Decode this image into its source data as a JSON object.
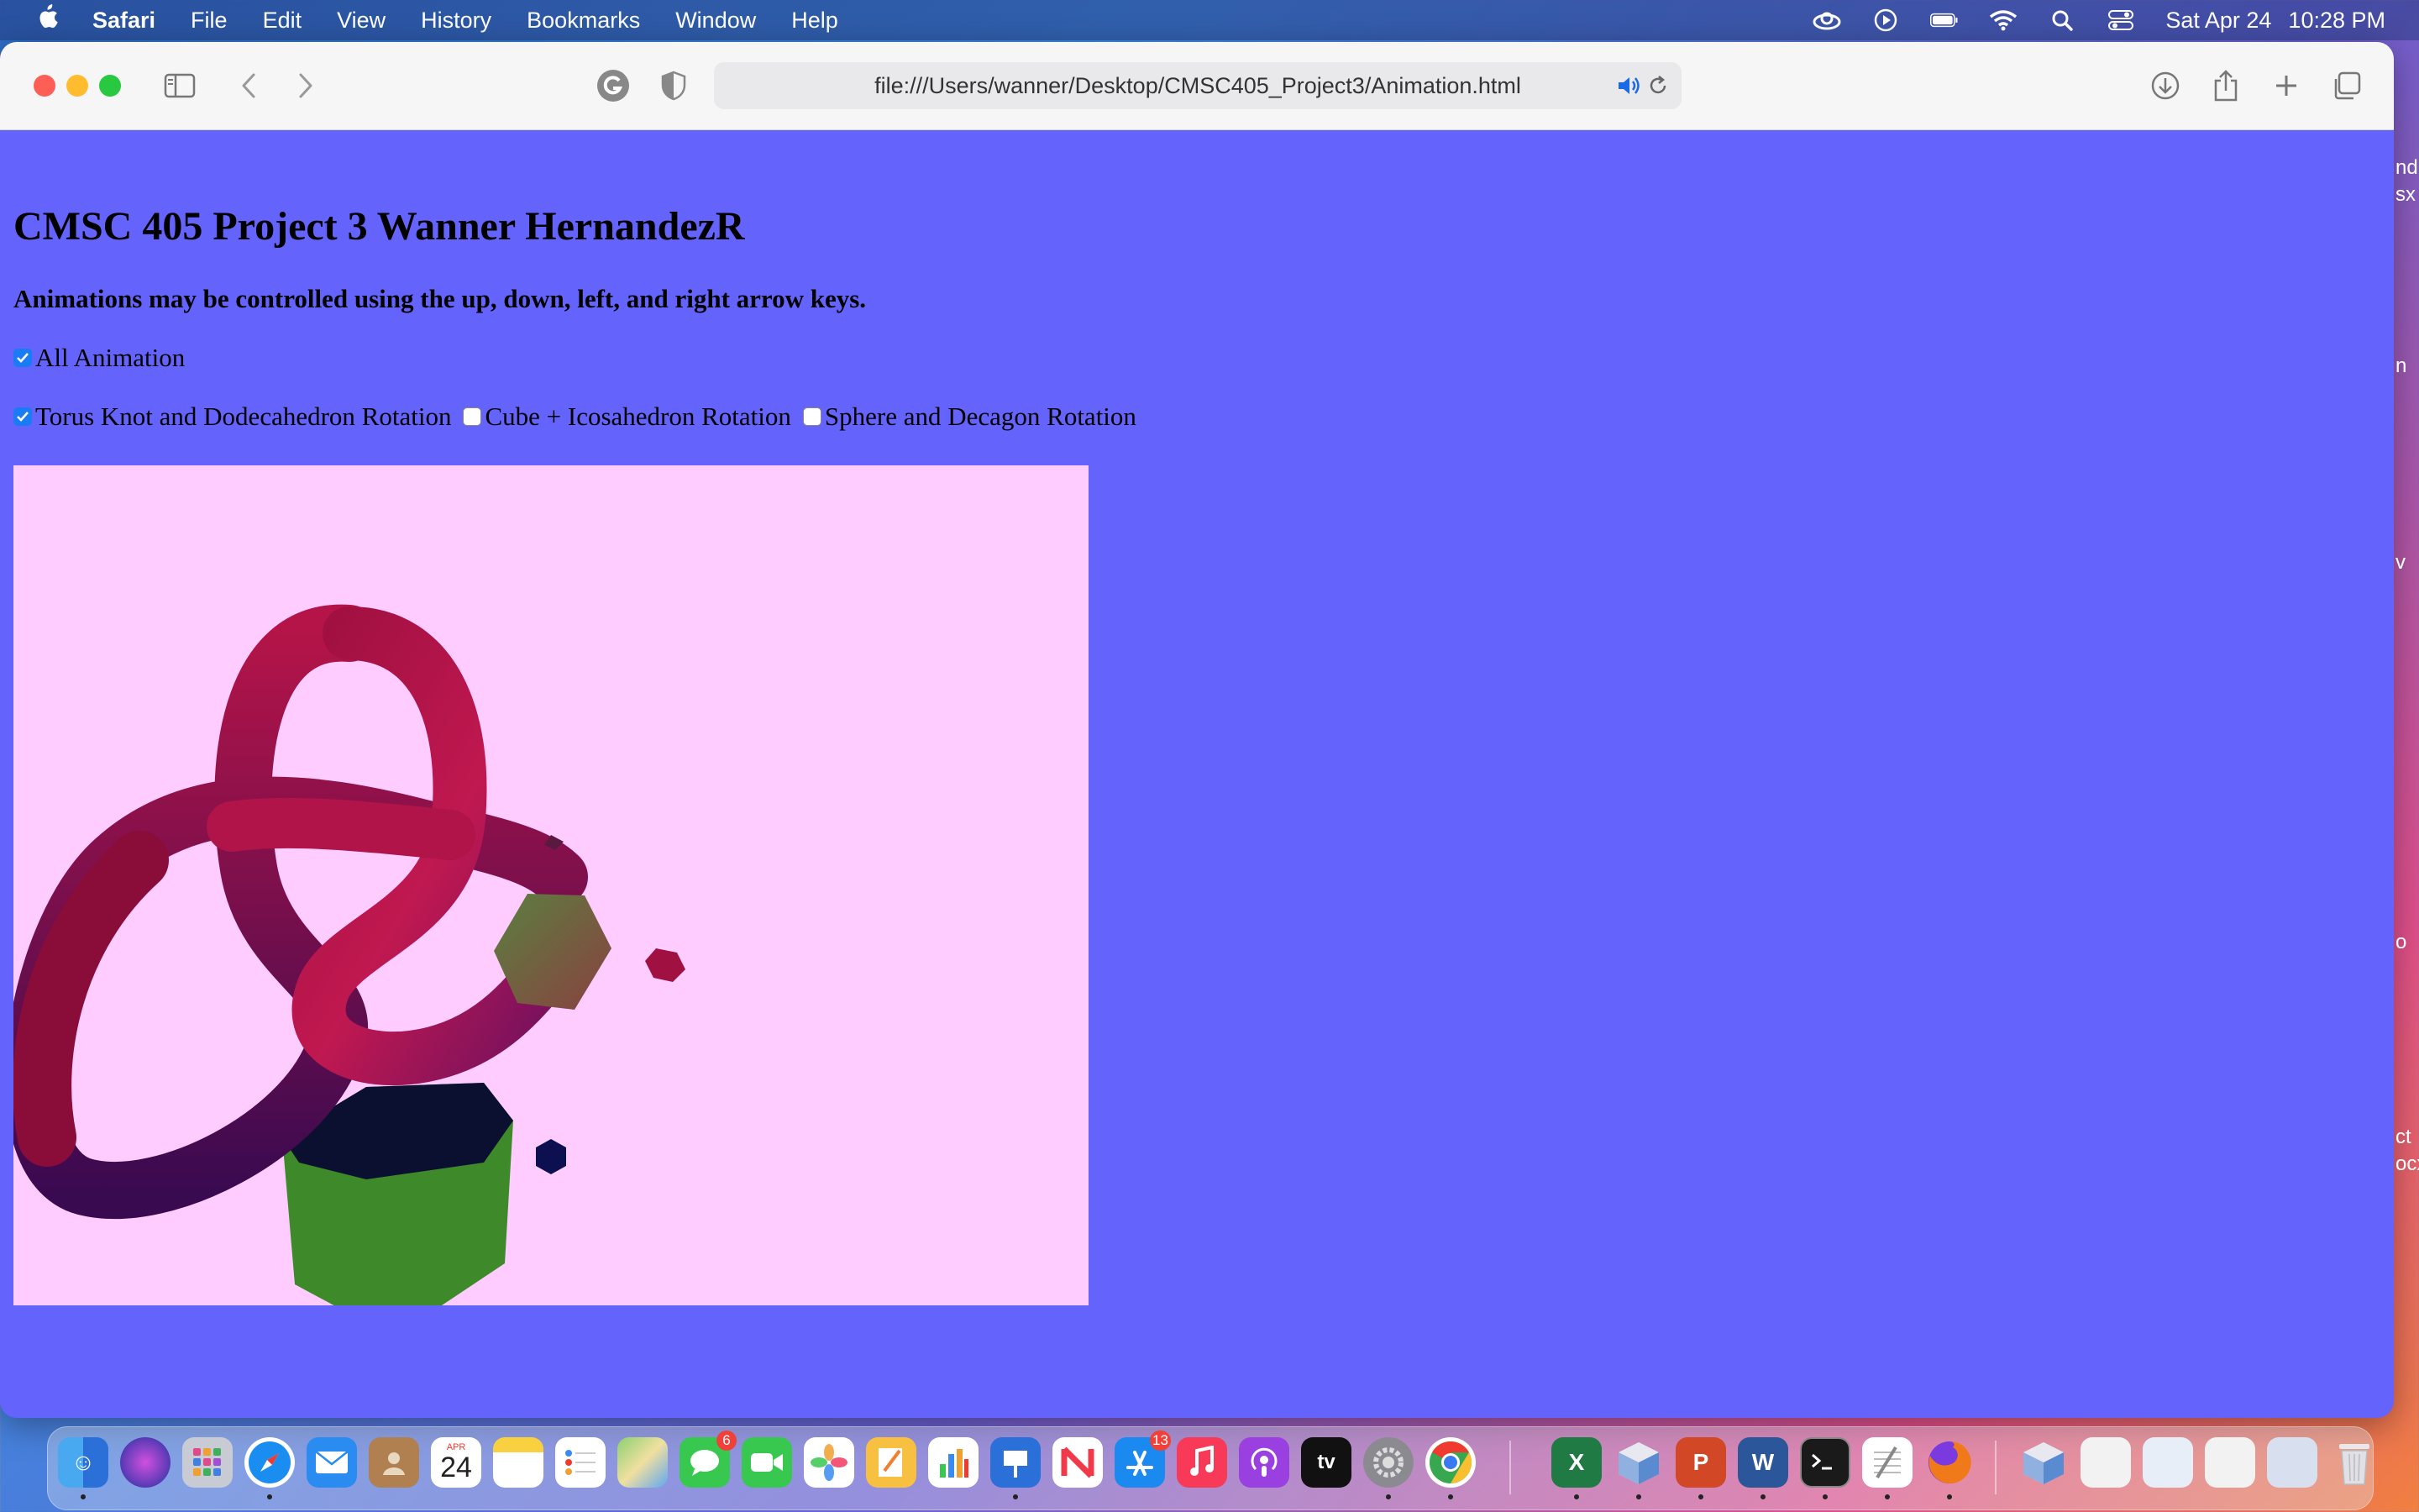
{
  "menubar": {
    "app_name": "Safari",
    "items": [
      "File",
      "Edit",
      "View",
      "History",
      "Bookmarks",
      "Window",
      "Help"
    ],
    "date": "Sat Apr 24",
    "time": "10:28 PM"
  },
  "browser": {
    "url": "file:///Users/wanner/Desktop/CMSC405_Project3/Animation.html"
  },
  "page": {
    "title": "CMSC 405 Project 3 Wanner HernandezR",
    "instructions": "Animations may be controlled using the up, down, left, and right arrow keys.",
    "all_animation": {
      "label": "All Animation",
      "checked": true
    },
    "options": [
      {
        "label": "Torus Knot and Dodecahedron Rotation",
        "checked": true
      },
      {
        "label": "Cube + Icosahedron Rotation",
        "checked": false
      },
      {
        "label": "Sphere and Decagon Rotation",
        "checked": false
      }
    ],
    "canvas_background": "#ffccff",
    "page_background": "#6464fc"
  },
  "desktop_edge_text": [
    "nd",
    "sx",
    "n",
    "v",
    "o",
    "ct",
    "ocx"
  ],
  "dock": {
    "calendar": {
      "month": "APR",
      "day": "24"
    },
    "messages_badge": "6",
    "appstore_badge": "13",
    "apple_tv_label": "tv",
    "word_letter": "W",
    "excel_letter": "X",
    "powerpoint_letter": "P"
  }
}
